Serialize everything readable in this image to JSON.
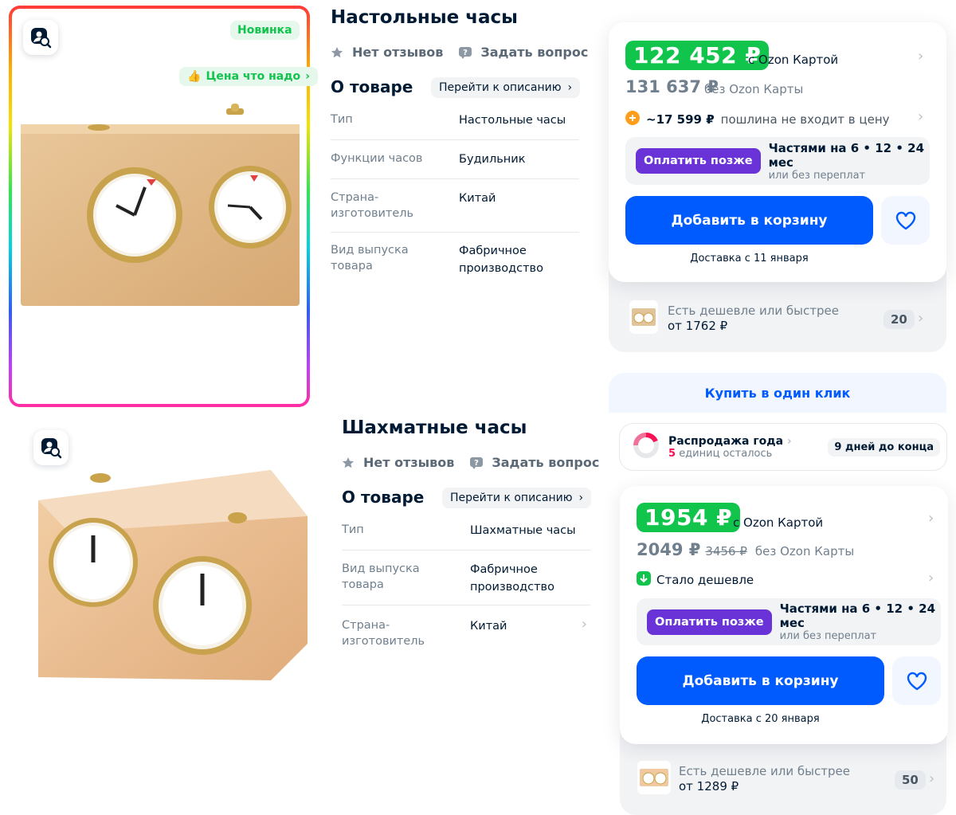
{
  "product1": {
    "badge_new": "Новинка",
    "badge_price": "Цена что надо",
    "title": "Настольные часы",
    "reviews": "Нет отзывов",
    "ask": "Задать вопрос",
    "about": "О товаре",
    "goto_desc": "Перейти к описанию",
    "specs": [
      {
        "k": "Тип",
        "v": "Настольные часы"
      },
      {
        "k": "Функции часов",
        "v": "Будильник"
      },
      {
        "k": "Страна-изготовитель",
        "v": "Китай"
      },
      {
        "k": "Вид выпуска товара",
        "v": "Фабричное производство"
      }
    ],
    "price_card": "122 452 ₽",
    "card_label": "с Ozon Картой",
    "price_nocard": "131 637 ₽",
    "nocard_label": "без Ozon Карты",
    "duty": "~17 599 ₽",
    "duty_label": "пошлина не входит в цену",
    "pay_later": "Оплатить позже",
    "installments": "Частями на 6 • 12 • 24 мес",
    "no_overpay": "или без переплат",
    "add_cart": "Добавить в корзину",
    "delivery": "Доставка с 11 января",
    "cheaper": "Есть дешевле или быстрее",
    "cheaper_from": "от 1762 ₽",
    "cheaper_count": "20",
    "one_click": "Купить в один клик"
  },
  "sale": {
    "title": "Распродажа года",
    "units_num": "5",
    "units_text": "единиц осталось",
    "days": "9 дней до конца"
  },
  "product2": {
    "title": "Шахматные часы",
    "reviews": "Нет отзывов",
    "ask": "Задать вопрос",
    "about": "О товаре",
    "goto_desc": "Перейти к описанию",
    "specs": [
      {
        "k": "Тип",
        "v": "Шахматные часы"
      },
      {
        "k": "Вид выпуска товара",
        "v": "Фабричное производство"
      },
      {
        "k": "Страна-изготовитель",
        "v": "Китай"
      }
    ],
    "price_card": "1954 ₽",
    "card_label": "с Ozon Картой",
    "price_nocard": "2049 ₽",
    "price_old": "3456 ₽",
    "nocard_label": "без Ozon Карты",
    "cheaper_tag": "Стало дешевле",
    "pay_later": "Оплатить позже",
    "installments": "Частями на 6 • 12 • 24 мес",
    "no_overpay": "или без переплат",
    "add_cart": "Добавить в корзину",
    "delivery": "Доставка с 20 января",
    "cheaper": "Есть дешевле или быстрее",
    "cheaper_from": "от 1289 ₽",
    "cheaper_count": "50"
  },
  "colors": {
    "accent": "#005bff",
    "green": "#10c44c",
    "purple": "#6a33d8"
  }
}
